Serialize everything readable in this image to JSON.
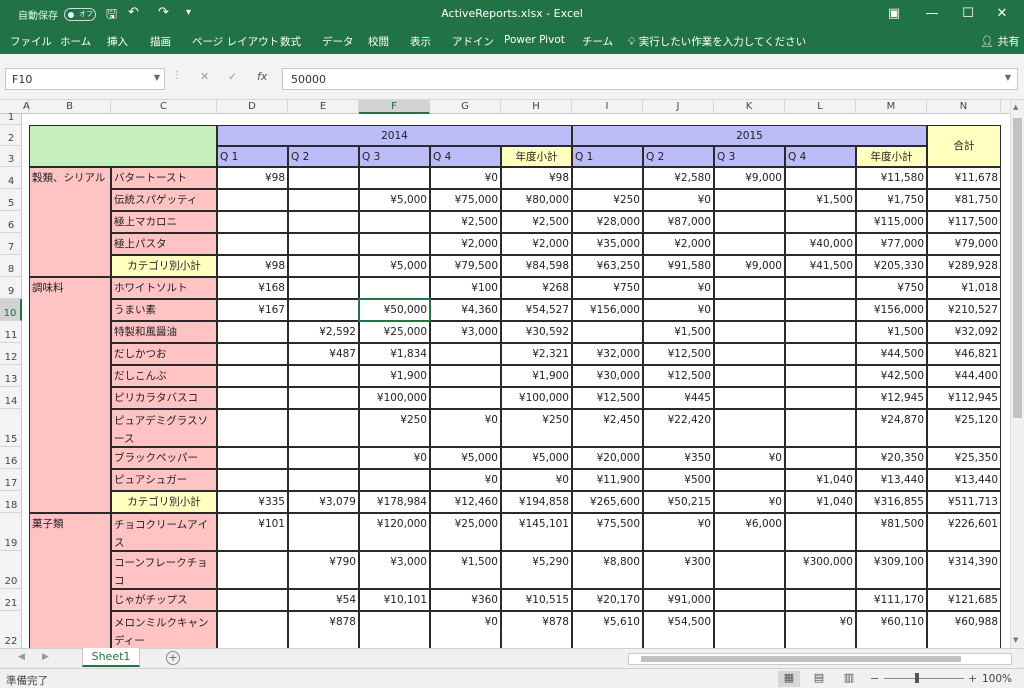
{
  "titlebar": {
    "autosave": "自動保存",
    "autosave_state": "オフ",
    "title": "ActiveReports.xlsx  -  Excel",
    "icons": [
      "save-icon",
      "undo-icon",
      "redo-icon",
      "customize-icon",
      "ribbon-display-icon",
      "minimize-icon",
      "maximize-icon",
      "close-icon"
    ]
  },
  "ribbon": {
    "tabs": [
      "ファイル",
      "ホーム",
      "挿入",
      "描画",
      "ページ レイアウト",
      "数式",
      "データ",
      "校閲",
      "表示",
      "アドイン",
      "Power Pivot",
      "チーム"
    ],
    "tell_me": "実行したい作業を入力してください",
    "share": "共有"
  },
  "formula_bar": {
    "name_box": "F10",
    "formula": "50000"
  },
  "columns": [
    "A",
    "B",
    "C",
    "D",
    "E",
    "F",
    "G",
    "H",
    "I",
    "J",
    "K",
    "L",
    "M",
    "N"
  ],
  "rows": [
    "1",
    "2",
    "3",
    "4",
    "5",
    "6",
    "7",
    "8",
    "9",
    "10",
    "11",
    "12",
    "13",
    "14",
    "15",
    "16",
    "17",
    "18",
    "19",
    "20",
    "21",
    "22"
  ],
  "selected_cell": {
    "column": "F",
    "row": "10"
  },
  "sheet": {
    "year1": "2014",
    "year2": "2015",
    "total_label": "合計",
    "quarters": [
      "Q 1",
      "Q 2",
      "Q 3",
      "Q 4",
      "年度小計",
      "Q 1",
      "Q 2",
      "Q 3",
      "Q 4",
      "年度小計"
    ],
    "categories": [
      "穀類、シリアル",
      "調味料",
      "菓子類"
    ],
    "rows": [
      {
        "product": "バタートースト",
        "v": [
          "¥98",
          "",
          "",
          "¥0",
          "¥98",
          "",
          "¥2,580",
          "¥9,000",
          "",
          "¥11,580",
          "¥11,678"
        ]
      },
      {
        "product": "伝統スパゲッティ",
        "v": [
          "",
          "",
          "¥5,000",
          "¥75,000",
          "¥80,000",
          "¥250",
          "¥0",
          "",
          "¥1,500",
          "¥1,750",
          "¥81,750"
        ]
      },
      {
        "product": "極上マカロニ",
        "v": [
          "",
          "",
          "",
          "¥2,500",
          "¥2,500",
          "¥28,000",
          "¥87,000",
          "",
          "",
          "¥115,000",
          "¥117,500"
        ]
      },
      {
        "product": "極上パスタ",
        "v": [
          "",
          "",
          "",
          "¥2,000",
          "¥2,000",
          "¥35,000",
          "¥2,000",
          "",
          "¥40,000",
          "¥77,000",
          "¥79,000"
        ]
      },
      {
        "product": "カテゴリ別小計",
        "v": [
          "¥98",
          "",
          "¥5,000",
          "¥79,500",
          "¥84,598",
          "¥63,250",
          "¥91,580",
          "¥9,000",
          "¥41,500",
          "¥205,330",
          "¥289,928"
        ]
      },
      {
        "product": "ホワイトソルト",
        "v": [
          "¥168",
          "",
          "",
          "¥100",
          "¥268",
          "¥750",
          "¥0",
          "",
          "",
          "¥750",
          "¥1,018"
        ]
      },
      {
        "product": "うまい素",
        "v": [
          "¥167",
          "",
          "¥50,000",
          "¥4,360",
          "¥54,527",
          "¥156,000",
          "¥0",
          "",
          "",
          "¥156,000",
          "¥210,527"
        ]
      },
      {
        "product": "特製和風醤油",
        "v": [
          "",
          "¥2,592",
          "¥25,000",
          "¥3,000",
          "¥30,592",
          "",
          "¥1,500",
          "",
          "",
          "¥1,500",
          "¥32,092"
        ]
      },
      {
        "product": "だしかつお",
        "v": [
          "",
          "¥487",
          "¥1,834",
          "",
          "¥2,321",
          "¥32,000",
          "¥12,500",
          "",
          "",
          "¥44,500",
          "¥46,821"
        ]
      },
      {
        "product": "だしこんぶ",
        "v": [
          "",
          "",
          "¥1,900",
          "",
          "¥1,900",
          "¥30,000",
          "¥12,500",
          "",
          "",
          "¥42,500",
          "¥44,400"
        ]
      },
      {
        "product": "ピリカラタバスコ",
        "v": [
          "",
          "",
          "¥100,000",
          "",
          "¥100,000",
          "¥12,500",
          "¥445",
          "",
          "",
          "¥12,945",
          "¥112,945"
        ]
      },
      {
        "product": "ピュアデミグラスソース",
        "v": [
          "",
          "",
          "¥250",
          "¥0",
          "¥250",
          "¥2,450",
          "¥22,420",
          "",
          "",
          "¥24,870",
          "¥25,120"
        ]
      },
      {
        "product": "ブラックペッパー",
        "v": [
          "",
          "",
          "¥0",
          "¥5,000",
          "¥5,000",
          "¥20,000",
          "¥350",
          "¥0",
          "",
          "¥20,350",
          "¥25,350"
        ]
      },
      {
        "product": "ピュアシュガー",
        "v": [
          "",
          "",
          "",
          "¥0",
          "¥0",
          "¥11,900",
          "¥500",
          "",
          "¥1,040",
          "¥13,440",
          "¥13,440"
        ]
      },
      {
        "product": "カテゴリ別小計",
        "v": [
          "¥335",
          "¥3,079",
          "¥178,984",
          "¥12,460",
          "¥194,858",
          "¥265,600",
          "¥50,215",
          "¥0",
          "¥1,040",
          "¥316,855",
          "¥511,713"
        ]
      },
      {
        "product": "チョコクリームアイス",
        "v": [
          "¥101",
          "",
          "¥120,000",
          "¥25,000",
          "¥145,101",
          "¥75,500",
          "¥0",
          "¥6,000",
          "",
          "¥81,500",
          "¥226,601"
        ]
      },
      {
        "product": "コーンフレークチョコ",
        "v": [
          "",
          "¥790",
          "¥3,000",
          "¥1,500",
          "¥5,290",
          "¥8,800",
          "¥300",
          "",
          "¥300,000",
          "¥309,100",
          "¥314,390"
        ]
      },
      {
        "product": "じゃがチップス",
        "v": [
          "",
          "¥54",
          "¥10,101",
          "¥360",
          "¥10,515",
          "¥20,170",
          "¥91,000",
          "",
          "",
          "¥111,170",
          "¥121,685"
        ]
      },
      {
        "product": "メロンミルクキャンディー",
        "v": [
          "",
          "¥878",
          "",
          "¥0",
          "¥878",
          "¥5,610",
          "¥54,500",
          "",
          "¥0",
          "¥60,110",
          "¥60,988"
        ]
      }
    ]
  },
  "sheet_tab": "Sheet1",
  "status": {
    "ready": "準備完了",
    "zoom": "100%"
  },
  "colors": {
    "excel_green": "#217346",
    "header_green": "#c6efbe",
    "year_blue": "#bcbcf9",
    "category_pink": "#ffc3c3",
    "subtotal_yellow": "#ffffc0"
  }
}
